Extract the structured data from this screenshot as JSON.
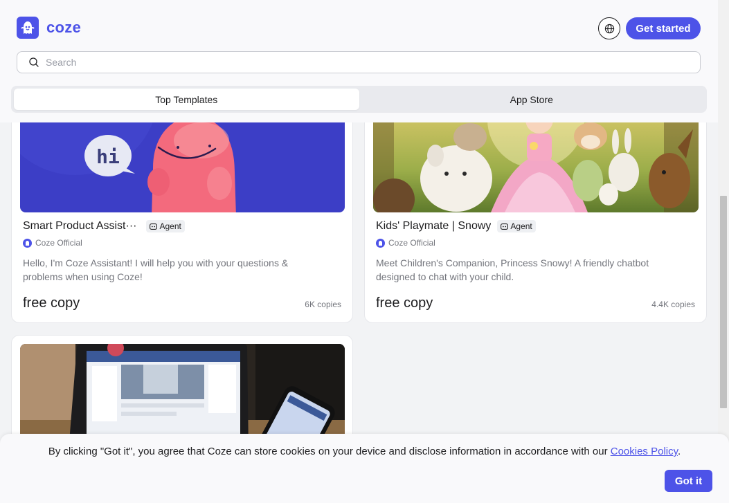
{
  "header": {
    "logo_text": "coze",
    "get_started_label": "Get started"
  },
  "search": {
    "placeholder": "Search",
    "value": ""
  },
  "tabs": [
    {
      "label": "Top Templates",
      "active": true
    },
    {
      "label": "App Store",
      "active": false
    }
  ],
  "cards": [
    {
      "title": "Smart Product Assist···",
      "tag": "Agent",
      "author": "Coze Official",
      "description": "Hello, I'm Coze Assistant! I will help you with your questions & problems when using Coze!",
      "price": "free copy",
      "copies": "6K copies",
      "thumb_text": "hi"
    },
    {
      "title": "Kids' Playmate | Snowy",
      "tag": "Agent",
      "author": "Coze Official",
      "description": "Meet Children's Companion, Princess Snowy! A friendly chatbot designed to chat with your child.",
      "price": "free copy",
      "copies": "4.4K copies"
    },
    {}
  ],
  "cookie_banner": {
    "text_before": "By clicking \"Got it\", you agree that Coze can store cookies on your device and disclose information in accordance with our ",
    "link_text": "Cookies Policy",
    "text_after": ".",
    "button_label": "Got it"
  },
  "colors": {
    "brand": "#4d53e8",
    "background": "#f2f3f5",
    "card": "#ffffff",
    "muted_text": "#73757c"
  }
}
